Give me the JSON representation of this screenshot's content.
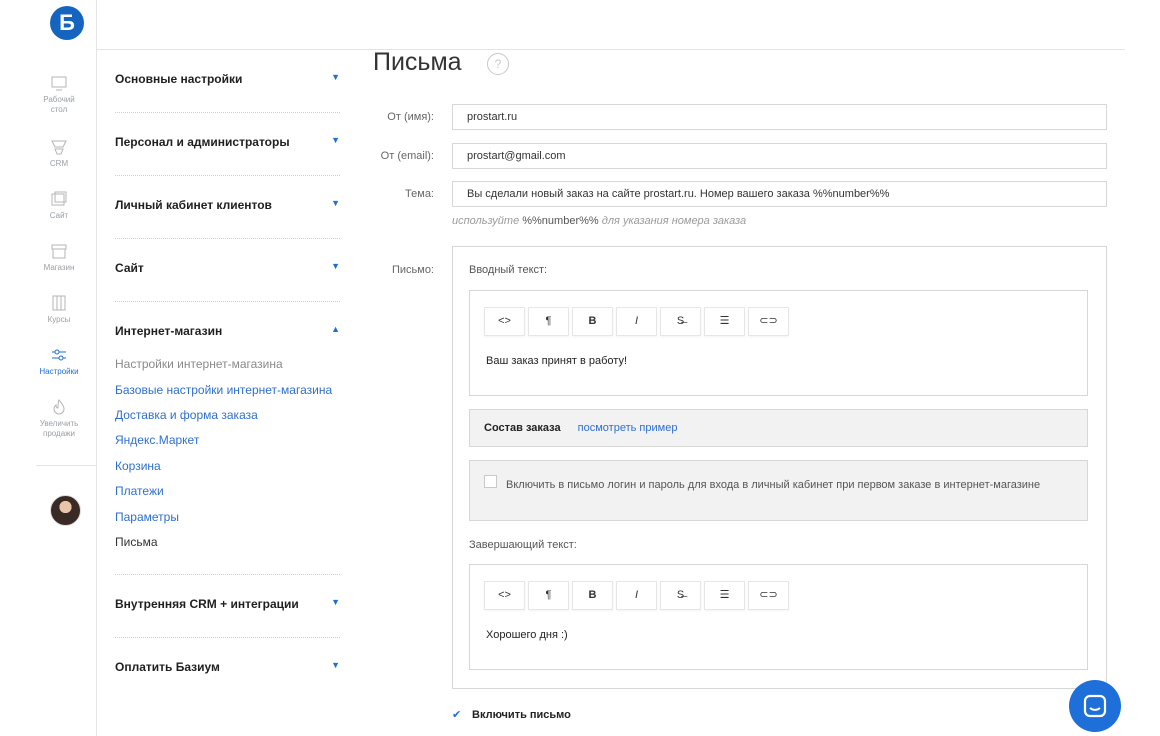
{
  "app": {
    "logo_letter": "Б"
  },
  "rail": {
    "items": [
      {
        "label": "Рабочий стол",
        "icon": "monitor-icon"
      },
      {
        "label": "CRM",
        "icon": "funnel-icon"
      },
      {
        "label": "Сайт",
        "icon": "browser-icon"
      },
      {
        "label": "Магазин",
        "icon": "store-icon"
      },
      {
        "label": "Курсы",
        "icon": "book-icon"
      },
      {
        "label": "Настройки",
        "icon": "sliders-icon",
        "active": true
      },
      {
        "label": "Увеличить продажи",
        "icon": "flame-icon"
      }
    ]
  },
  "menu": {
    "sections": [
      {
        "title": "Основные настройки",
        "arrow": "▼"
      },
      {
        "title": "Персонал и администраторы",
        "arrow": "▼"
      },
      {
        "title": "Личный кабинет клиентов",
        "arrow": "▼"
      },
      {
        "title": "Сайт",
        "arrow": "▼"
      },
      {
        "title": "Интернет-магазин",
        "arrow": "▲"
      },
      {
        "title": "Внутренняя CRM + интеграции",
        "arrow": "▼"
      },
      {
        "title": "Оплатить Базиум",
        "arrow": "▼"
      }
    ],
    "shop_items": [
      "Настройки интернет-магазина",
      "Базовые настройки интернет-магазина",
      "Доставка и форма заказа",
      "Яндекс.Маркет",
      "Корзина",
      "Платежи",
      "Параметры",
      "Письма"
    ]
  },
  "main": {
    "title": "Письма",
    "help": "?",
    "from_name_label": "От (имя):",
    "from_name_value": "prostart.ru",
    "from_email_label": "От (email):",
    "from_email_value": "prostart@gmail.com",
    "subject_label": "Тема:",
    "subject_value": "Вы сделали новый заказ на сайте prostart.ru. Номер вашего заказа %%number%%",
    "hint_prefix": "используйте",
    "hint_code": "%%number%%",
    "hint_suffix": "для указания номера заказа",
    "letter_label": "Письмо:",
    "intro_label": "Вводный текст:",
    "intro_text": "Ваш заказ принят в работу!",
    "order_title": "Состав заказа",
    "order_link": "посмотреть пример",
    "login_text": "Включить в письмо логин и пароль для входа в личный кабинет при первом заказе в интернет-магазине",
    "closing_label": "Завершающий текст:",
    "closing_text": "Хорошего дня :)",
    "enable_label": "Включить письмо",
    "enable_checked": true
  },
  "toolbar": {
    "buttons": [
      {
        "glyph": "<>",
        "icon": "code-icon"
      },
      {
        "glyph": "¶",
        "icon": "paragraph-icon"
      },
      {
        "glyph": "B",
        "icon": "bold-icon"
      },
      {
        "glyph": "I",
        "icon": "italic-icon"
      },
      {
        "glyph": "S̶",
        "icon": "strikethrough-icon"
      },
      {
        "glyph": "☰",
        "icon": "list-icon"
      },
      {
        "glyph": "⊂⊃",
        "icon": "link-icon"
      }
    ]
  },
  "colors": {
    "accent": "#1e6fd9",
    "logo": "#1565c0"
  }
}
